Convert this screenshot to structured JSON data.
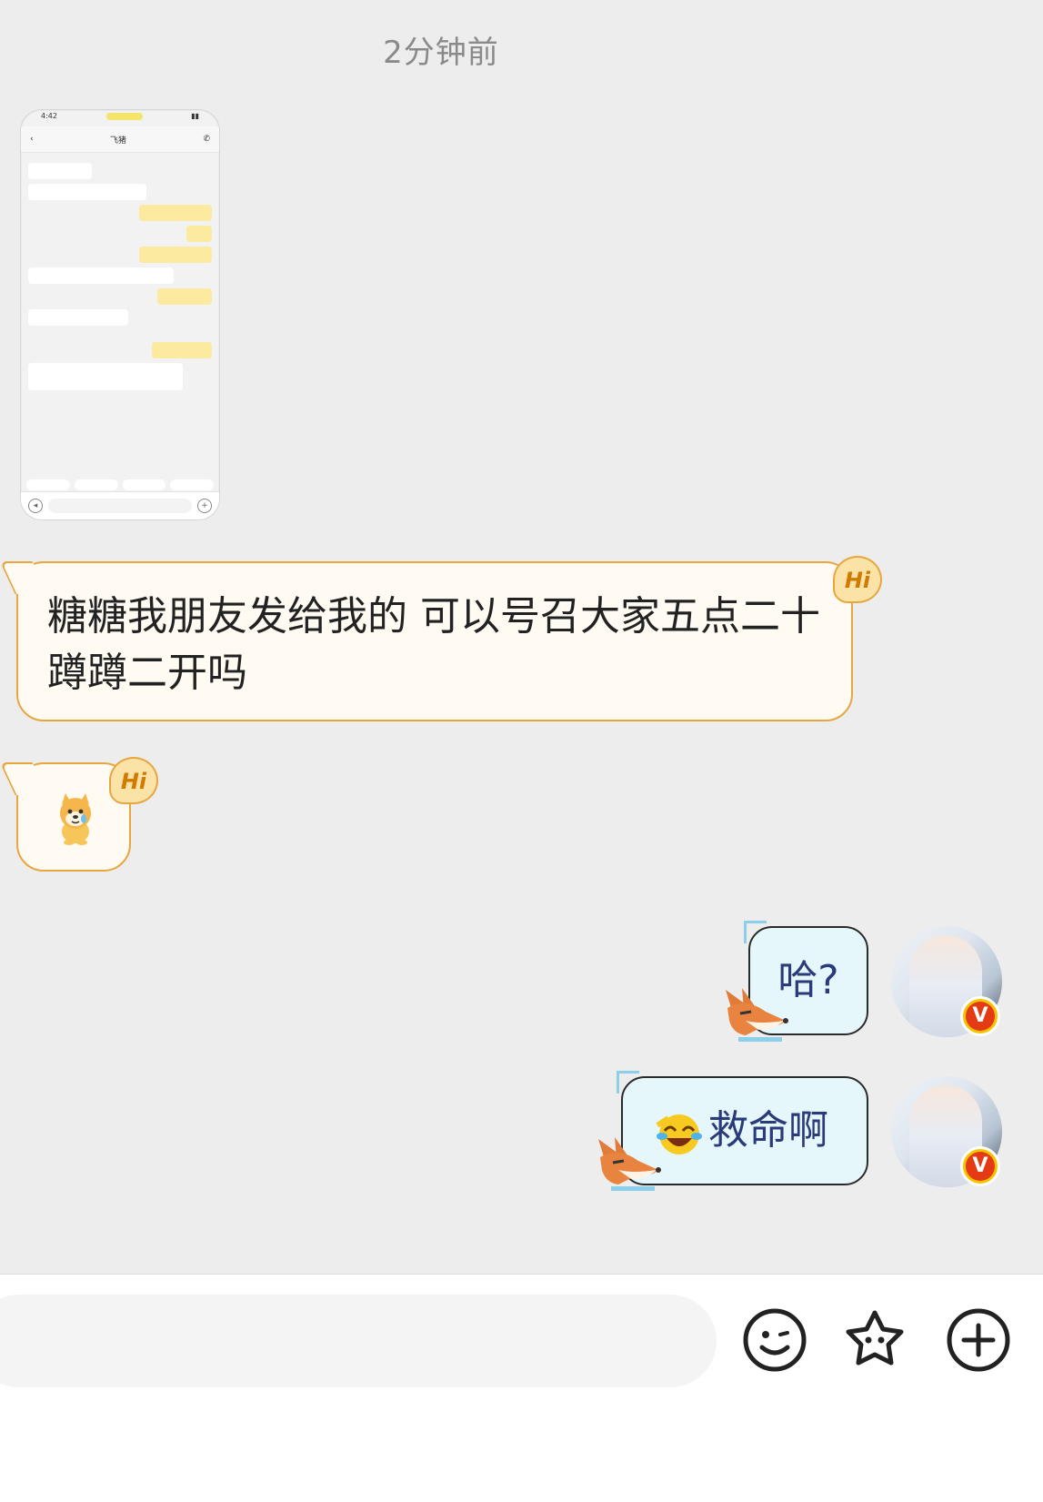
{
  "timestamp": "2分钟前",
  "thumbnail": {
    "status_time": "4:42",
    "title": "飞猪"
  },
  "messages": [
    {
      "type": "image",
      "side": "left",
      "name": "screenshot-thumbnail"
    },
    {
      "type": "text",
      "side": "left",
      "text": "糖糖我朋友发给我的 可以号召大家五点二十蹲蹲二开吗",
      "badge": "Hi"
    },
    {
      "type": "sticker",
      "side": "left",
      "sticker": "dog-crying-sticker",
      "badge": "Hi"
    },
    {
      "type": "text",
      "side": "right",
      "text": "哈?"
    },
    {
      "type": "text",
      "side": "right",
      "text": "救命啊",
      "emoji": "laughing-crying-emoji"
    }
  ],
  "avatar_badge": "V",
  "input": {
    "placeholder": "",
    "value": ""
  },
  "toolbar": {
    "emoji": "smiley-icon",
    "favorite": "star-face-icon",
    "more": "plus-icon"
  },
  "colors": {
    "incoming_border": "#e8a640",
    "incoming_bg": "#fffbf2",
    "outgoing_bg": "#e6f7fc",
    "outgoing_text": "#2b3b7a",
    "background": "#ededed"
  }
}
